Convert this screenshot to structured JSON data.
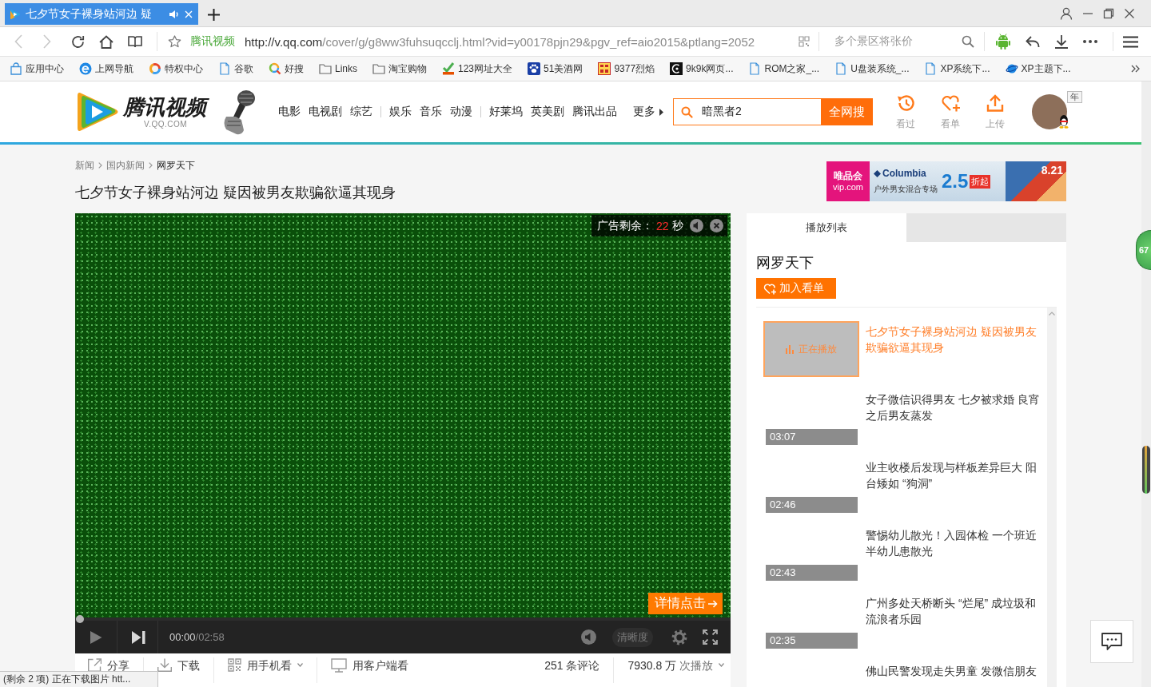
{
  "browser": {
    "tabs": [
      {
        "title": "七夕节女子裸身站河边 疑",
        "selected": true,
        "audio": true
      }
    ],
    "navigation": {
      "back_disabled": true,
      "forward_disabled": true
    },
    "address": {
      "site_label": "腾讯视频",
      "host": "http://v.qq.com",
      "path": "/cover/g/g8ww3fuhsuqcclj.html?vid=y00178pjn29&pgv_ref=aio2015&ptlang=2052"
    },
    "search": {
      "placeholder": "多个景区将张价"
    },
    "bookmarks": [
      {
        "label": "应用中心",
        "kind": "bag"
      },
      {
        "label": "上网导航",
        "kind": "ie"
      },
      {
        "label": "特权中心",
        "kind": "ring"
      },
      {
        "label": "谷歌",
        "kind": "page"
      },
      {
        "label": "好搜",
        "kind": "search"
      },
      {
        "label": "Links",
        "kind": "folder"
      },
      {
        "label": "淘宝购物",
        "kind": "folder"
      },
      {
        "label": "123网址大全",
        "kind": "hao"
      },
      {
        "label": "51美酒网",
        "kind": "paw"
      },
      {
        "label": "9377烈焰",
        "kind": "grid"
      },
      {
        "label": "9k9k网页...",
        "kind": "dark"
      },
      {
        "label": "ROM之家_...",
        "kind": "page"
      },
      {
        "label": "U盘装系统_...",
        "kind": "page"
      },
      {
        "label": "XP系统下...",
        "kind": "page"
      },
      {
        "label": "XP主题下...",
        "kind": "globe"
      }
    ]
  },
  "site_header": {
    "logo_text": "腾讯视频",
    "logo_sub": "V.QQ.COM",
    "nav_groups": [
      [
        "电影",
        "电视剧",
        "综艺"
      ],
      [
        "娱乐",
        "音乐",
        "动漫"
      ],
      [
        "好莱坞",
        "英美剧",
        "腾讯出品"
      ]
    ],
    "more": "更多",
    "search": {
      "value": "暗黑者2",
      "button": "全网搜"
    },
    "actions": [
      {
        "label": "看过",
        "kind": "history"
      },
      {
        "label": "看单",
        "kind": "watchlist"
      },
      {
        "label": "上传",
        "kind": "upload"
      }
    ],
    "user": {
      "tag": "年"
    }
  },
  "page": {
    "breadcrumb": [
      {
        "label": "新闻",
        "current": false
      },
      {
        "label": "国内新闻",
        "current": false
      },
      {
        "label": "网罗天下",
        "current": true
      }
    ],
    "title": "七夕节女子裸身站河边 疑因被男友欺骗欲逼其现身"
  },
  "ad_banner": {
    "brand": "唯品会",
    "brand_url": "vip.com",
    "partner": "Columbia",
    "tagline": "户外男女混合专场",
    "discount": "2.5",
    "discount_label": "折起",
    "date": "8.21"
  },
  "player": {
    "ad": {
      "label": "广告剩余：",
      "seconds": "22",
      "unit": "秒"
    },
    "detail_button": "详情点击",
    "progress": {
      "level": 0
    },
    "time": {
      "current": "00:00",
      "total": "/02:58"
    },
    "quality": "清晰度"
  },
  "video_actions": {
    "items": [
      {
        "label": "分享",
        "kind": "share",
        "dropdown": false
      },
      {
        "label": "下载",
        "kind": "download",
        "dropdown": false
      },
      {
        "label": "用手机看",
        "kind": "phone",
        "dropdown": true
      },
      {
        "label": "用客户端看",
        "kind": "client",
        "dropdown": false
      }
    ],
    "comments": {
      "count": "251",
      "label": "条评论"
    },
    "plays": {
      "count": "7930.8 万",
      "label": "次播放",
      "dropdown": true
    }
  },
  "playlist": {
    "tabs": [
      {
        "label": "播放列表",
        "selected": true
      }
    ],
    "series": "网罗天下",
    "add_button": "加入看单",
    "items": [
      {
        "title": "七夕节女子裸身站河边 疑因被男友欺骗欲逼其现身",
        "selected": true,
        "status": "正在播放"
      },
      {
        "title": "女子微信识得男友 七夕被求婚 良宵之后男友蒸发",
        "duration": "03:07",
        "selected": false
      },
      {
        "title": "业主收楼后发现与样板差异巨大 阳台矮如 “狗洞”",
        "duration": "02:46",
        "selected": false
      },
      {
        "title": "警惕幼儿散光！入园体检 一个班近半幼儿患散光",
        "duration": "02:43",
        "selected": false
      },
      {
        "title": "广州多处天桥断头 “烂尾” 成垃圾和流浪者乐园",
        "duration": "02:35",
        "selected": false
      },
      {
        "title": "佛山民警发现走失男童 发微信朋友",
        "selected": false
      }
    ]
  },
  "status_bubble": "(剩余 2 项) 正在下载图片 htt...",
  "float_ball": "67"
}
